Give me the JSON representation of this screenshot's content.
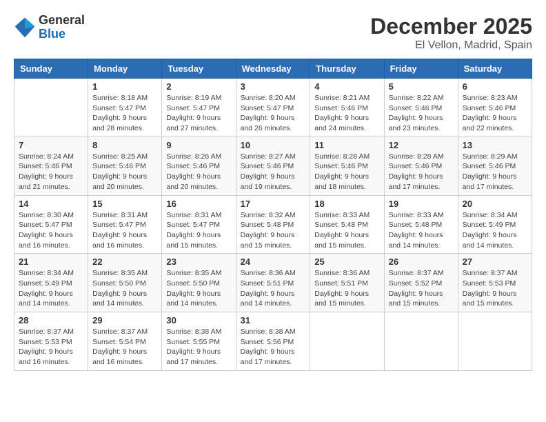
{
  "logo": {
    "line1": "General",
    "line2": "Blue"
  },
  "title": "December 2025",
  "location": "El Vellon, Madrid, Spain",
  "days_of_week": [
    "Sunday",
    "Monday",
    "Tuesday",
    "Wednesday",
    "Thursday",
    "Friday",
    "Saturday"
  ],
  "weeks": [
    [
      {
        "day": "",
        "info": ""
      },
      {
        "day": "1",
        "info": "Sunrise: 8:18 AM\nSunset: 5:47 PM\nDaylight: 9 hours\nand 28 minutes."
      },
      {
        "day": "2",
        "info": "Sunrise: 8:19 AM\nSunset: 5:47 PM\nDaylight: 9 hours\nand 27 minutes."
      },
      {
        "day": "3",
        "info": "Sunrise: 8:20 AM\nSunset: 5:47 PM\nDaylight: 9 hours\nand 26 minutes."
      },
      {
        "day": "4",
        "info": "Sunrise: 8:21 AM\nSunset: 5:46 PM\nDaylight: 9 hours\nand 24 minutes."
      },
      {
        "day": "5",
        "info": "Sunrise: 8:22 AM\nSunset: 5:46 PM\nDaylight: 9 hours\nand 23 minutes."
      },
      {
        "day": "6",
        "info": "Sunrise: 8:23 AM\nSunset: 5:46 PM\nDaylight: 9 hours\nand 22 minutes."
      }
    ],
    [
      {
        "day": "7",
        "info": "Sunrise: 8:24 AM\nSunset: 5:46 PM\nDaylight: 9 hours\nand 21 minutes."
      },
      {
        "day": "8",
        "info": "Sunrise: 8:25 AM\nSunset: 5:46 PM\nDaylight: 9 hours\nand 20 minutes."
      },
      {
        "day": "9",
        "info": "Sunrise: 8:26 AM\nSunset: 5:46 PM\nDaylight: 9 hours\nand 20 minutes."
      },
      {
        "day": "10",
        "info": "Sunrise: 8:27 AM\nSunset: 5:46 PM\nDaylight: 9 hours\nand 19 minutes."
      },
      {
        "day": "11",
        "info": "Sunrise: 8:28 AM\nSunset: 5:46 PM\nDaylight: 9 hours\nand 18 minutes."
      },
      {
        "day": "12",
        "info": "Sunrise: 8:28 AM\nSunset: 5:46 PM\nDaylight: 9 hours\nand 17 minutes."
      },
      {
        "day": "13",
        "info": "Sunrise: 8:29 AM\nSunset: 5:46 PM\nDaylight: 9 hours\nand 17 minutes."
      }
    ],
    [
      {
        "day": "14",
        "info": "Sunrise: 8:30 AM\nSunset: 5:47 PM\nDaylight: 9 hours\nand 16 minutes."
      },
      {
        "day": "15",
        "info": "Sunrise: 8:31 AM\nSunset: 5:47 PM\nDaylight: 9 hours\nand 16 minutes."
      },
      {
        "day": "16",
        "info": "Sunrise: 8:31 AM\nSunset: 5:47 PM\nDaylight: 9 hours\nand 15 minutes."
      },
      {
        "day": "17",
        "info": "Sunrise: 8:32 AM\nSunset: 5:48 PM\nDaylight: 9 hours\nand 15 minutes."
      },
      {
        "day": "18",
        "info": "Sunrise: 8:33 AM\nSunset: 5:48 PM\nDaylight: 9 hours\nand 15 minutes."
      },
      {
        "day": "19",
        "info": "Sunrise: 8:33 AM\nSunset: 5:48 PM\nDaylight: 9 hours\nand 14 minutes."
      },
      {
        "day": "20",
        "info": "Sunrise: 8:34 AM\nSunset: 5:49 PM\nDaylight: 9 hours\nand 14 minutes."
      }
    ],
    [
      {
        "day": "21",
        "info": "Sunrise: 8:34 AM\nSunset: 5:49 PM\nDaylight: 9 hours\nand 14 minutes."
      },
      {
        "day": "22",
        "info": "Sunrise: 8:35 AM\nSunset: 5:50 PM\nDaylight: 9 hours\nand 14 minutes."
      },
      {
        "day": "23",
        "info": "Sunrise: 8:35 AM\nSunset: 5:50 PM\nDaylight: 9 hours\nand 14 minutes."
      },
      {
        "day": "24",
        "info": "Sunrise: 8:36 AM\nSunset: 5:51 PM\nDaylight: 9 hours\nand 14 minutes."
      },
      {
        "day": "25",
        "info": "Sunrise: 8:36 AM\nSunset: 5:51 PM\nDaylight: 9 hours\nand 15 minutes."
      },
      {
        "day": "26",
        "info": "Sunrise: 8:37 AM\nSunset: 5:52 PM\nDaylight: 9 hours\nand 15 minutes."
      },
      {
        "day": "27",
        "info": "Sunrise: 8:37 AM\nSunset: 5:53 PM\nDaylight: 9 hours\nand 15 minutes."
      }
    ],
    [
      {
        "day": "28",
        "info": "Sunrise: 8:37 AM\nSunset: 5:53 PM\nDaylight: 9 hours\nand 16 minutes."
      },
      {
        "day": "29",
        "info": "Sunrise: 8:37 AM\nSunset: 5:54 PM\nDaylight: 9 hours\nand 16 minutes."
      },
      {
        "day": "30",
        "info": "Sunrise: 8:38 AM\nSunset: 5:55 PM\nDaylight: 9 hours\nand 17 minutes."
      },
      {
        "day": "31",
        "info": "Sunrise: 8:38 AM\nSunset: 5:56 PM\nDaylight: 9 hours\nand 17 minutes."
      },
      {
        "day": "",
        "info": ""
      },
      {
        "day": "",
        "info": ""
      },
      {
        "day": "",
        "info": ""
      }
    ]
  ]
}
